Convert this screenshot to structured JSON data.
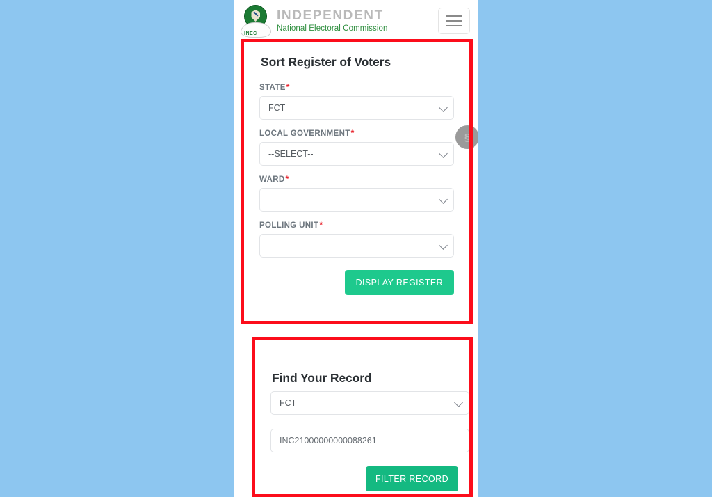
{
  "background_color": "#8dc6f0",
  "accent_colors": {
    "annotation_red": "#fc0d1b",
    "button_green": "#1ec98d",
    "button_green_dark": "#14b981",
    "brand_green": "#2f8f3f",
    "brand_gray": "#b9b9b9",
    "required_star_red": "#e8202a"
  },
  "header": {
    "logo_name": "inec-coat-of-arms-logo",
    "logo_badge_text": "INEC",
    "brand_line_1": "INDEPENDENT",
    "brand_line_2": "National Electoral Commission",
    "menu_toggle_name": "hamburger-menu-icon"
  },
  "floating_widget": {
    "glyph": "§"
  },
  "sort_register_card": {
    "title": "Sort Register of Voters",
    "fields": [
      {
        "label": "STATE",
        "required": true,
        "required_marker": "*",
        "value": "FCT",
        "control": "select"
      },
      {
        "label": "LOCAL GOVERNMENT",
        "required": true,
        "required_marker": "*",
        "value": "--SELECT--",
        "control": "select"
      },
      {
        "label": "WARD",
        "required": true,
        "required_marker": "*",
        "value": "-",
        "control": "select"
      },
      {
        "label": "POLLING UNIT",
        "required": true,
        "required_marker": "*",
        "value": "-",
        "control": "select"
      }
    ],
    "submit_label": "DISPLAY REGISTER"
  },
  "find_record_card": {
    "title": "Find Your Record",
    "state_value": "FCT",
    "vin_value": "INC21000000000088261",
    "vin_placeholder": "INC21000000000088261",
    "submit_label": "FILTER RECORD"
  }
}
